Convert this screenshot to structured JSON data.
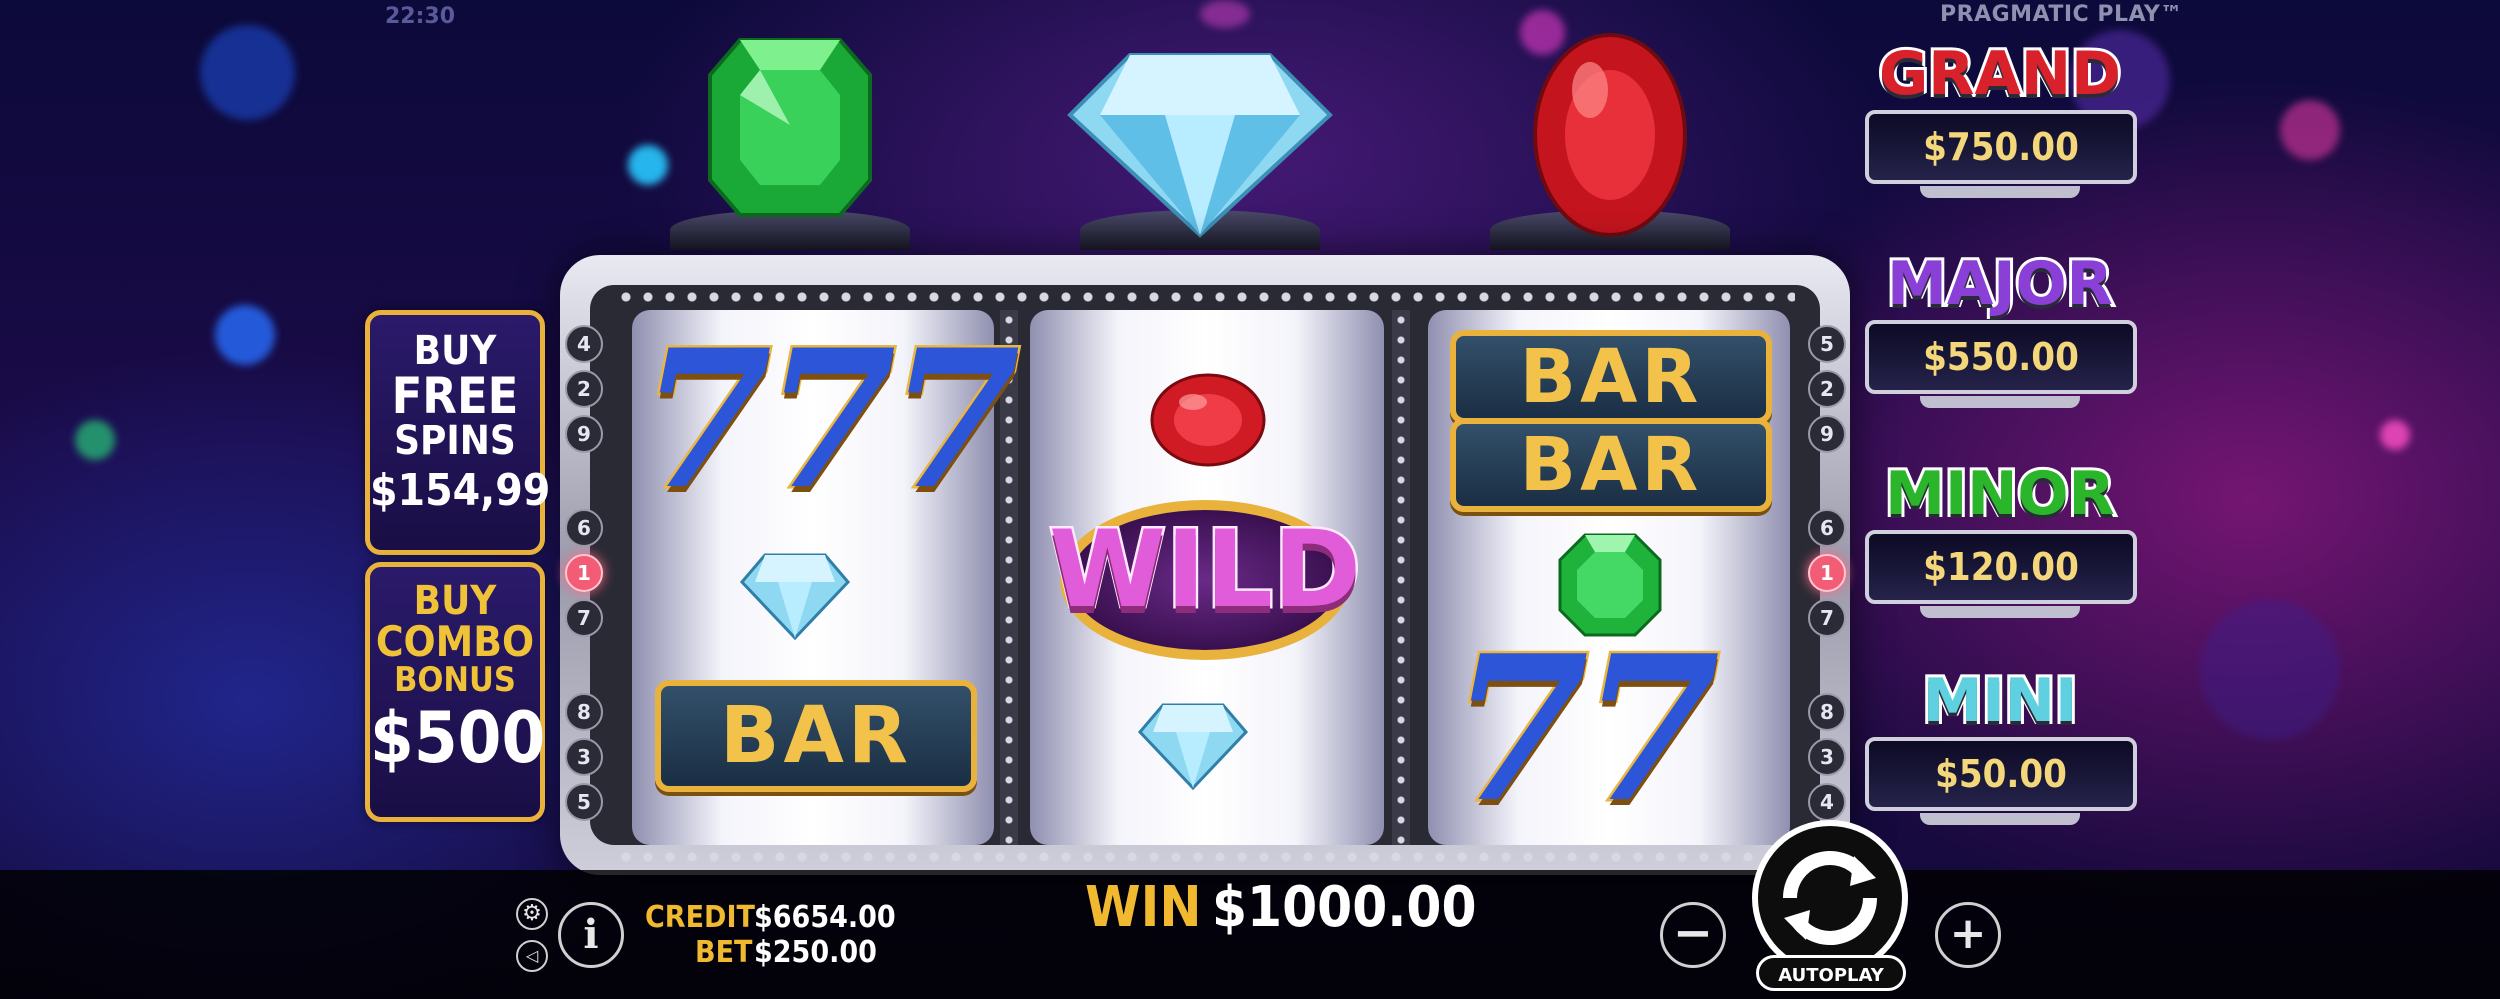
{
  "status": {
    "clock": "22:30",
    "provider": "PRAGMATIC PLAY™"
  },
  "buy_free_spins": {
    "line1": "BUY",
    "line2": "FREE",
    "line3": "SPINS",
    "price": "$154,99"
  },
  "buy_combo_bonus": {
    "line1": "BUY",
    "line2": "COMBO",
    "line3": "BONUS",
    "price": "$500"
  },
  "reels": {
    "left_numbers": [
      "4",
      "2",
      "9",
      "6",
      "1",
      "7",
      "8",
      "3",
      "5"
    ],
    "right_numbers": [
      "5",
      "2",
      "9",
      "6",
      "1",
      "7",
      "8",
      "3",
      "4"
    ],
    "active_number": "1",
    "reel1": {
      "top": "777",
      "middle": "diamond",
      "bottom": "BAR"
    },
    "reel2": {
      "top": "ruby",
      "middle": "WILD",
      "bottom": "diamond"
    },
    "reel3": {
      "top": [
        "BAR",
        "BAR"
      ],
      "middle": "emerald",
      "bottom": "77"
    }
  },
  "jackpots": [
    {
      "name": "GRAND",
      "amount": "$750.00",
      "color": "#d8212b"
    },
    {
      "name": "MAJOR",
      "amount": "$550.00",
      "color": "#8a3fd6"
    },
    {
      "name": "MINOR",
      "amount": "$120.00",
      "color": "#2bb52b"
    },
    {
      "name": "MINI",
      "amount": "$50.00",
      "color": "#5fd0e0"
    }
  ],
  "bottom_bar": {
    "credit_label": "CREDIT",
    "credit_value": "$6654.00",
    "bet_label": "BET",
    "bet_value": "$250.00",
    "win_label": "WIN",
    "win_value": "$1000.00",
    "autoplay_label": "AUTOPLAY"
  },
  "colors": {
    "gold": "#e8b23c",
    "win_gold": "#f0b930"
  }
}
